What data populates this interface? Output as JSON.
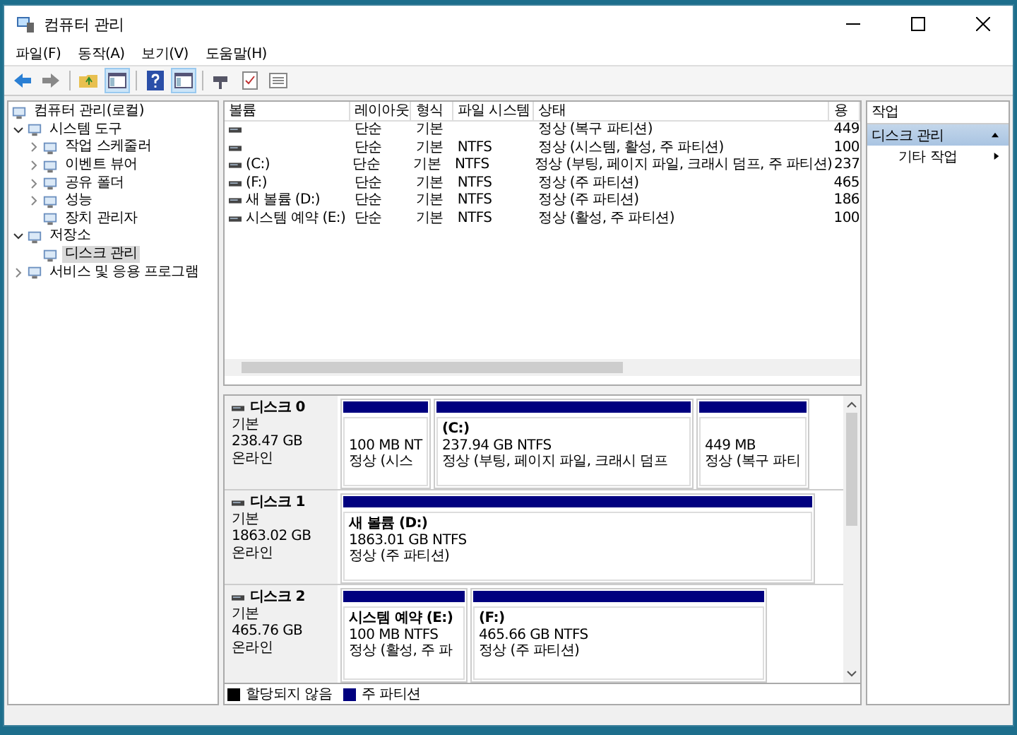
{
  "window": {
    "title": "컴퓨터 관리"
  },
  "menu": [
    "파일(F)",
    "동작(A)",
    "보기(V)",
    "도움말(H)"
  ],
  "toolbar": [
    {
      "kind": "back",
      "on": false
    },
    {
      "kind": "forward",
      "on": false
    },
    {
      "kind": "sep"
    },
    {
      "kind": "up",
      "on": false
    },
    {
      "kind": "panel",
      "on": true
    },
    {
      "kind": "sep"
    },
    {
      "kind": "help",
      "on": false
    },
    {
      "kind": "panel",
      "on": true
    },
    {
      "kind": "sep"
    },
    {
      "kind": "connect",
      "on": false
    },
    {
      "kind": "check",
      "on": false
    },
    {
      "kind": "list",
      "on": false
    }
  ],
  "tree": [
    {
      "label": "컴퓨터 관리(로컬)",
      "selected": false,
      "children": [
        {
          "label": "시스템 도구",
          "expanded": true,
          "selected": false,
          "children": [
            {
              "label": "작업 스케줄러",
              "expanded": false,
              "selected": false
            },
            {
              "label": "이벤트 뷰어",
              "expanded": false,
              "selected": false
            },
            {
              "label": "공유 폴더",
              "expanded": false,
              "selected": false
            },
            {
              "label": "성능",
              "expanded": false,
              "selected": false
            },
            {
              "label": "장치 관리자",
              "selected": false
            }
          ]
        },
        {
          "label": "저장소",
          "expanded": true,
          "selected": false,
          "children": [
            {
              "label": "디스크 관리",
              "selected": true
            }
          ]
        },
        {
          "label": "서비스 및 응용 프로그램",
          "expanded": false,
          "selected": false
        }
      ]
    }
  ],
  "table": {
    "columns": [
      "볼륨",
      "레이아웃",
      "형식",
      "파일 시스템",
      "상태",
      "용"
    ],
    "rows": [
      {
        "volume": "",
        "layout": "단순",
        "type": "기본",
        "fs": "",
        "status": "정상 (복구 파티션)",
        "capacity": "449"
      },
      {
        "volume": "",
        "layout": "단순",
        "type": "기본",
        "fs": "NTFS",
        "status": "정상 (시스템, 활성, 주 파티션)",
        "capacity": "100"
      },
      {
        "volume": "(C:)",
        "layout": "단순",
        "type": "기본",
        "fs": "NTFS",
        "status": "정상 (부팅, 페이지 파일, 크래시 덤프, 주 파티션)",
        "capacity": "237"
      },
      {
        "volume": "(F:)",
        "layout": "단순",
        "type": "기본",
        "fs": "NTFS",
        "status": "정상 (주 파티션)",
        "capacity": "465"
      },
      {
        "volume": "새 볼륨 (D:)",
        "layout": "단순",
        "type": "기본",
        "fs": "NTFS",
        "status": "정상 (주 파티션)",
        "capacity": "186"
      },
      {
        "volume": "시스템 예약 (E:)",
        "layout": "단순",
        "type": "기본",
        "fs": "NTFS",
        "status": "정상 (활성, 주 파티션)",
        "capacity": "100"
      }
    ]
  },
  "disks": [
    {
      "name": "디스크 0",
      "type": "기본",
      "size": "238.47 GB",
      "status": "온라인",
      "partitions": [
        {
          "size": "100 MB NT",
          "status": "정상 (시스"
        },
        {
          "label": "(C:)",
          "size": "237.94 GB NTFS",
          "status": "정상 (부팅, 페이지 파일, 크래시 덤프"
        },
        {
          "size": "449 MB",
          "status": "정상 (복구 파티"
        }
      ]
    },
    {
      "name": "디스크 1",
      "type": "기본",
      "size": "1863.02 GB",
      "status": "온라인",
      "partitions": [
        {
          "label": "새 볼륨  (D:)",
          "size": "1863.01 GB NTFS",
          "status": "정상 (주 파티션)"
        }
      ]
    },
    {
      "name": "디스크 2",
      "type": "기본",
      "size": "465.76 GB",
      "status": "온라인",
      "partitions": [
        {
          "label": "시스템 예약  (E:)",
          "size": "100 MB NTFS",
          "status": "정상 (활성, 주 파"
        },
        {
          "label": "(F:)",
          "size": "465.66 GB NTFS",
          "status": "정상 (주 파티션)"
        }
      ]
    }
  ],
  "legend": [
    {
      "label": "할당되지 않음",
      "color": "#000000"
    },
    {
      "label": "주 파티션",
      "color": "#00007f"
    }
  ],
  "actions": {
    "title": "작업",
    "sections": [
      {
        "title": "디스크 관리",
        "expanded": true,
        "items": [
          "기타 작업"
        ]
      }
    ]
  }
}
